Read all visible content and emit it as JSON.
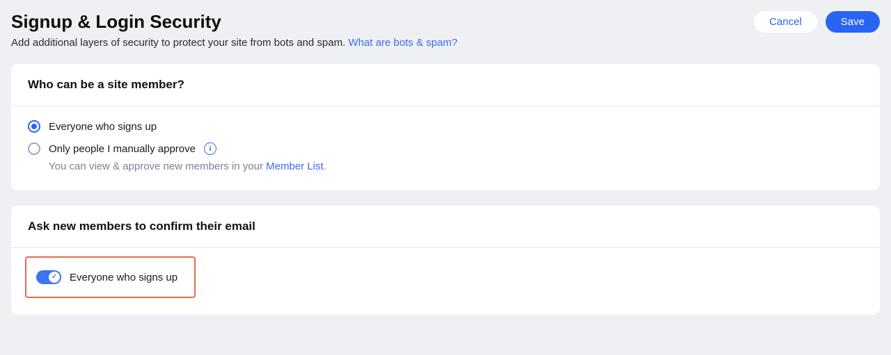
{
  "header": {
    "title": "Signup & Login Security",
    "subtitle_prefix": "Add additional layers of security to protect your site from bots and spam. ",
    "subtitle_link": "What are bots & spam?",
    "cancel_label": "Cancel",
    "save_label": "Save"
  },
  "card_membership": {
    "title": "Who can be a site member?",
    "option_everyone": "Everyone who signs up",
    "option_manual": "Only people I manually approve",
    "info_glyph": "i",
    "helper_prefix": "You can view & approve new members in your ",
    "helper_link": "Member List",
    "helper_suffix": "."
  },
  "card_confirm_email": {
    "title": "Ask new members to confirm their email",
    "toggle_label": "Everyone who signs up",
    "toggle_check": "✓"
  }
}
